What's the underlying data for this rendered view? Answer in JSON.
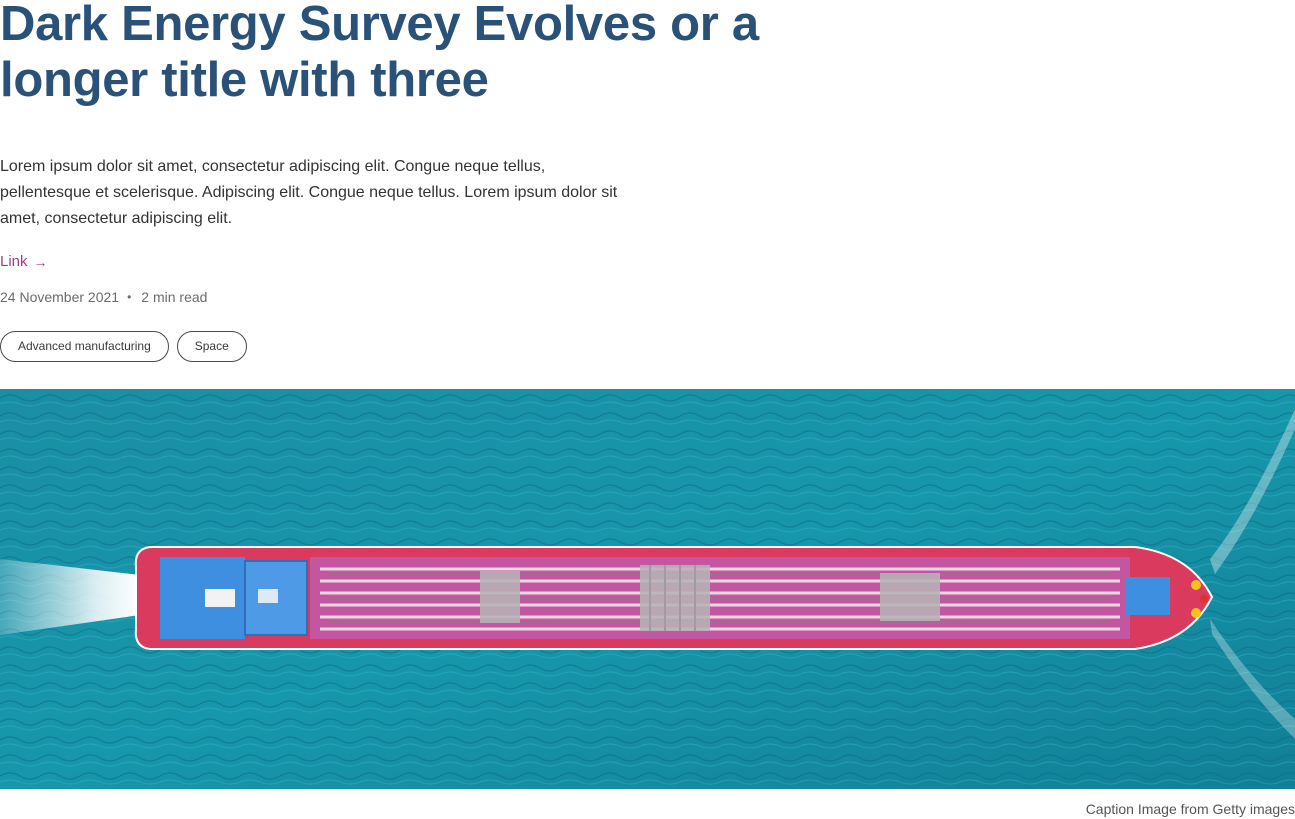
{
  "article": {
    "title": "Dark Energy Survey Evolves or a longer title with three",
    "summary": "Lorem ipsum dolor sit amet, consectetur adipiscing elit. Congue neque tellus, pellentesque et scelerisque. Adipiscing elit. Congue neque tellus. Lorem ipsum dolor sit amet, consectetur adipiscing elit.",
    "link_label": "Link",
    "link_icon": "arrow-right-icon",
    "date": "24 November 2021",
    "separator": "•",
    "read_time": "2 min read",
    "tags": [
      "Advanced manufacturing",
      "Space"
    ]
  },
  "hero_image": {
    "caption": "Caption Image from Getty images"
  },
  "colors": {
    "title": "#2a5178",
    "link": "#9c3f8c",
    "water": "#1b8fa5",
    "hull": "#d93a5e",
    "deck": "#c455a0"
  }
}
